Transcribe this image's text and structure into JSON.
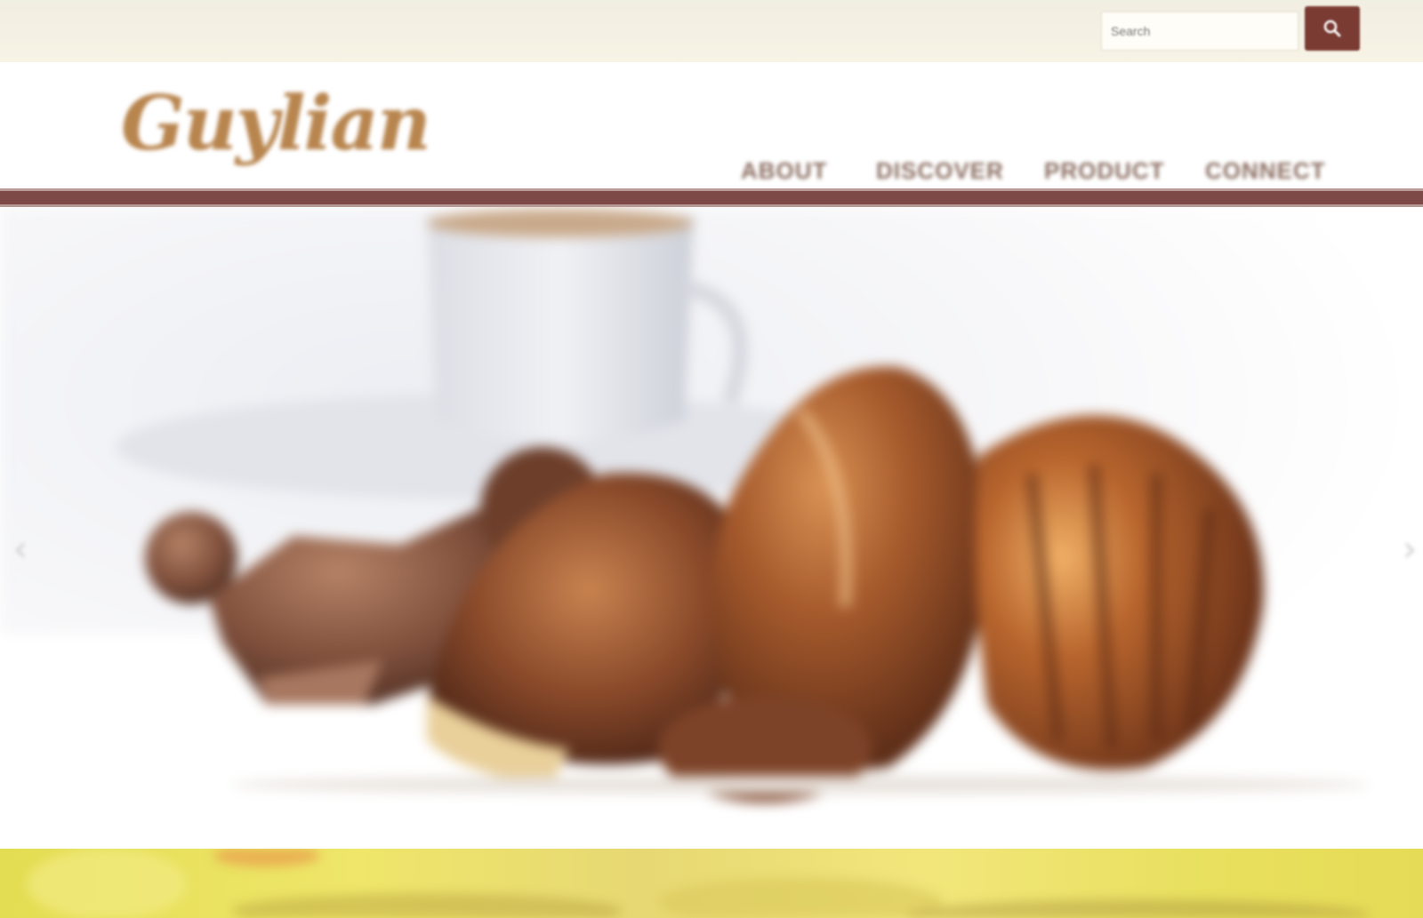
{
  "search": {
    "placeholder": "Search",
    "button_icon": "search-icon"
  },
  "brand": {
    "logo_text": "Guylian",
    "logo_color": "#b8854e"
  },
  "nav": {
    "items": [
      {
        "label": "ABOUT"
      },
      {
        "label": "DISCOVER"
      },
      {
        "label": "PRODUCT"
      },
      {
        "label": "CONNECT"
      }
    ]
  },
  "colors": {
    "accent": "#7a3b33",
    "rule": "#7d4a47",
    "topbar": "#f4f0e3",
    "banner": "#e8df5e"
  },
  "hero": {
    "left_arrow_icon": "chevron-left-icon",
    "right_arrow_icon": "chevron-right-icon"
  }
}
